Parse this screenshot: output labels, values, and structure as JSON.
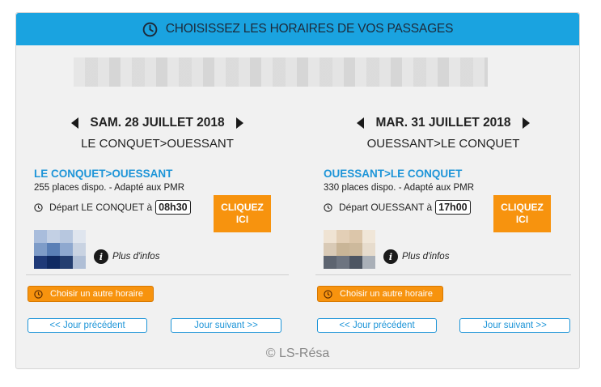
{
  "header": {
    "title": "CHOISISSEZ LES HORAIRES DE VOS PASSAGES"
  },
  "columns": [
    {
      "date": "SAM. 28 JUILLET 2018",
      "route": "LE CONQUET>OUESSANT",
      "trip_name": "LE CONQUET>OUESSANT",
      "places": "255 places dispo. - Adapté aux PMR",
      "depart_label": "Départ LE CONQUET à",
      "depart_time": "08h30",
      "cta_line1": "CLIQUEZ",
      "cta_line2": "ICI",
      "more_info": "Plus d'infos",
      "other_schedule": "Choisir un autre horaire",
      "prev_day": "<< Jour précédent",
      "next_day": "Jour suivant >>"
    },
    {
      "date": "MAR. 31 JUILLET 2018",
      "route": "OUESSANT>LE CONQUET",
      "trip_name": "OUESSANT>LE CONQUET",
      "places": "330 places dispo. - Adapté aux PMR",
      "depart_label": "Départ OUESSANT à",
      "depart_time": "17h00",
      "cta_line1": "CLIQUEZ",
      "cta_line2": "ICI",
      "more_info": "Plus d'infos",
      "other_schedule": "Choisir un autre horaire",
      "prev_day": "<< Jour précédent",
      "next_day": "Jour suivant >>"
    }
  ],
  "footer": {
    "copyright": "© LS-Résa"
  },
  "colors": {
    "header_bg": "#1aa3e0",
    "accent_orange": "#f7930e",
    "link_blue": "#1e95d8",
    "panel_bg": "#f1f1f1"
  },
  "icons": [
    "clock-icon",
    "prev-arrow-icon",
    "next-arrow-icon",
    "info-icon"
  ]
}
